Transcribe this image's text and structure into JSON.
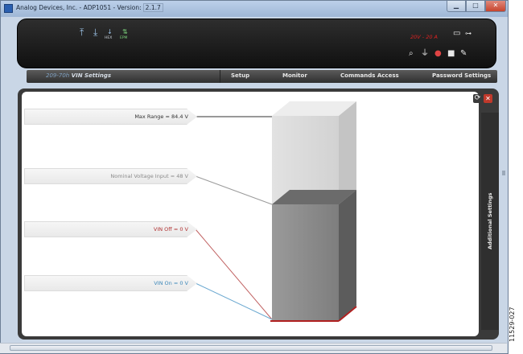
{
  "window": {
    "title": "Analog Devices, Inc. - ADP1051 - Version:",
    "version": "2.1.7"
  },
  "toolbar": {
    "hex_label": "HEX",
    "epm_label": "EPM",
    "readout": "20V - 20 A"
  },
  "nav": {
    "breadcrumb_prefix": "209-70h",
    "breadcrumb_title": "VIN Settings",
    "items": [
      {
        "label": "Setup"
      },
      {
        "label": "Monitor"
      },
      {
        "label": "Commands Access"
      },
      {
        "label": "Password Settings"
      }
    ]
  },
  "labels": {
    "max_range": "Max Range = 84.4 V",
    "nominal": "Nominal Voltage Input = 48 V",
    "vin_off": "VIN Off = 0 V",
    "vin_on": "VIN On = 0 V"
  },
  "colors": {
    "max_range": "#333333",
    "nominal": "#8a8a8a",
    "vin_off": "#b03030",
    "vin_on": "#3b86b8"
  },
  "side_panel": {
    "label": "Additional Settings"
  },
  "figure_id": "11529-027",
  "icons": [
    "upload-icon",
    "download-icon",
    "hex-icon",
    "epm-icon",
    "search-icon",
    "network-icon",
    "alert-icon",
    "lock-icon",
    "pen-icon",
    "monitor-icon",
    "usb-icon",
    "refresh-icon",
    "close-icon"
  ]
}
